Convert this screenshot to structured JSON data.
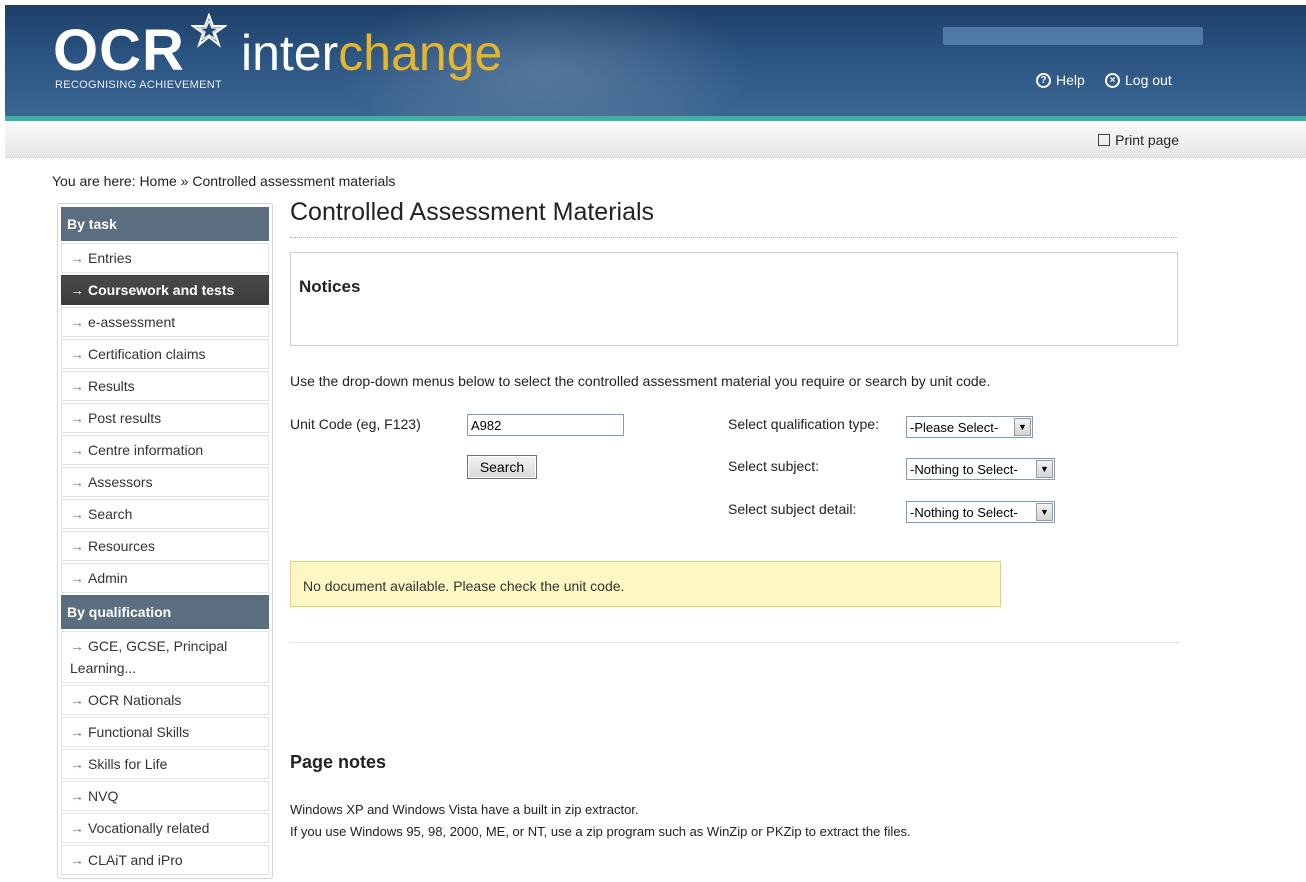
{
  "header": {
    "logo_text": "OCR",
    "logo_tagline": "RECOGNISING ACHIEVEMENT",
    "product_part1": "inter",
    "product_part2": "change",
    "help_label": "Help",
    "logout_label": "Log out"
  },
  "toolbar": {
    "print_label": "Print page"
  },
  "breadcrumb": {
    "text": "You are here: Home » Controlled assessment materials"
  },
  "sidebar": {
    "by_task_heading": "By task",
    "task_items": [
      "Entries",
      "Coursework and tests",
      "e-assessment",
      "Certification claims",
      "Results",
      "Post results",
      "Centre information",
      "Assessors",
      "Search",
      "Resources",
      "Admin"
    ],
    "active_item": "Coursework and tests",
    "by_qual_heading": "By qualification",
    "qual_items": [
      "GCE, GCSE, Principal Learning...",
      "OCR Nationals",
      "Functional Skills",
      "Skills for Life",
      "NVQ",
      "Vocationally related",
      "CLAiT and iPro"
    ]
  },
  "main": {
    "title": "Controlled Assessment Materials",
    "notices_heading": "Notices",
    "instructions": "Use the drop-down menus below to select the controlled assessment material you require or search by unit code.",
    "unit_code_label": "Unit Code (eg, F123)",
    "unit_code_value": "A982",
    "search_label": "Search",
    "qual_type_label": "Select qualification type:",
    "qual_type_value": "-Please Select-",
    "subject_label": "Select subject:",
    "subject_value": "-Nothing to Select-",
    "subject_detail_label": "Select subject detail:",
    "subject_detail_value": "-Nothing to Select-",
    "warning": "No document available. Please check the unit code.",
    "page_notes_heading": "Page notes",
    "note_line1": "Windows XP and Windows Vista have a built in zip extractor.",
    "note_line2": "If you use Windows 95, 98, 2000, ME, or NT, use a zip program such as WinZip or PKZip to extract the files."
  },
  "colors": {
    "header_bg": "#2b5482",
    "teal_stripe": "#3fb0a6",
    "brand_yellow": "#e5b52b",
    "sidebar_heading": "#5a6e80",
    "active_item": "#3c3c3c",
    "warning_bg": "#fdf7c3"
  }
}
